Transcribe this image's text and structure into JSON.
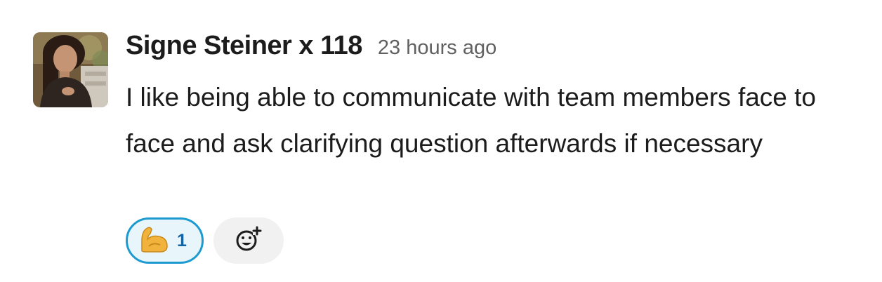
{
  "message": {
    "author": "Signe Steiner x 118",
    "timestamp": "23 hours ago",
    "text": "I like being able to communicate with team members face to face and ask clarifying question afterwards if necessary"
  },
  "reactions": [
    {
      "emoji_icon": "flexed-biceps-icon",
      "count": "1",
      "active": true
    }
  ],
  "add_reaction_icon": "add-reaction-icon",
  "colors": {
    "active_border": "#1d9bd1",
    "active_background": "#e8f5fa",
    "count_text": "#1264a3",
    "add_background": "#f1f1f1"
  }
}
